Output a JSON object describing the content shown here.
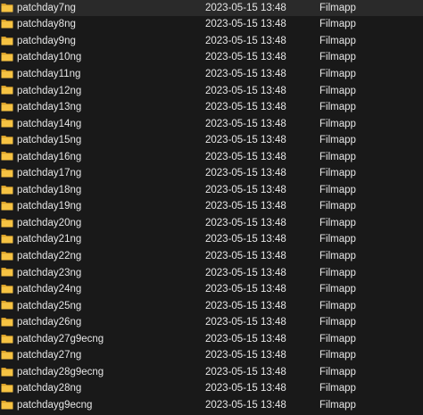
{
  "icon": "folder-icon",
  "colors": {
    "background": "#191919",
    "text": "#e6e6e6",
    "folder_front": "#f6c343",
    "folder_back": "#d9a12a"
  },
  "rows": [
    {
      "name": "patchday7ng",
      "date": "2023-05-15 13:48",
      "type": "Filmapp"
    },
    {
      "name": "patchday8ng",
      "date": "2023-05-15 13:48",
      "type": "Filmapp"
    },
    {
      "name": "patchday9ng",
      "date": "2023-05-15 13:48",
      "type": "Filmapp"
    },
    {
      "name": "patchday10ng",
      "date": "2023-05-15 13:48",
      "type": "Filmapp"
    },
    {
      "name": "patchday11ng",
      "date": "2023-05-15 13:48",
      "type": "Filmapp"
    },
    {
      "name": "patchday12ng",
      "date": "2023-05-15 13:48",
      "type": "Filmapp"
    },
    {
      "name": "patchday13ng",
      "date": "2023-05-15 13:48",
      "type": "Filmapp"
    },
    {
      "name": "patchday14ng",
      "date": "2023-05-15 13:48",
      "type": "Filmapp"
    },
    {
      "name": "patchday15ng",
      "date": "2023-05-15 13:48",
      "type": "Filmapp"
    },
    {
      "name": "patchday16ng",
      "date": "2023-05-15 13:48",
      "type": "Filmapp"
    },
    {
      "name": "patchday17ng",
      "date": "2023-05-15 13:48",
      "type": "Filmapp"
    },
    {
      "name": "patchday18ng",
      "date": "2023-05-15 13:48",
      "type": "Filmapp"
    },
    {
      "name": "patchday19ng",
      "date": "2023-05-15 13:48",
      "type": "Filmapp"
    },
    {
      "name": "patchday20ng",
      "date": "2023-05-15 13:48",
      "type": "Filmapp"
    },
    {
      "name": "patchday21ng",
      "date": "2023-05-15 13:48",
      "type": "Filmapp"
    },
    {
      "name": "patchday22ng",
      "date": "2023-05-15 13:48",
      "type": "Filmapp"
    },
    {
      "name": "patchday23ng",
      "date": "2023-05-15 13:48",
      "type": "Filmapp"
    },
    {
      "name": "patchday24ng",
      "date": "2023-05-15 13:48",
      "type": "Filmapp"
    },
    {
      "name": "patchday25ng",
      "date": "2023-05-15 13:48",
      "type": "Filmapp"
    },
    {
      "name": "patchday26ng",
      "date": "2023-05-15 13:48",
      "type": "Filmapp"
    },
    {
      "name": "patchday27g9ecng",
      "date": "2023-05-15 13:48",
      "type": "Filmapp"
    },
    {
      "name": "patchday27ng",
      "date": "2023-05-15 13:48",
      "type": "Filmapp"
    },
    {
      "name": "patchday28g9ecng",
      "date": "2023-05-15 13:48",
      "type": "Filmapp"
    },
    {
      "name": "patchday28ng",
      "date": "2023-05-15 13:48",
      "type": "Filmapp"
    },
    {
      "name": "patchdayg9ecng",
      "date": "2023-05-15 13:48",
      "type": "Filmapp"
    }
  ]
}
